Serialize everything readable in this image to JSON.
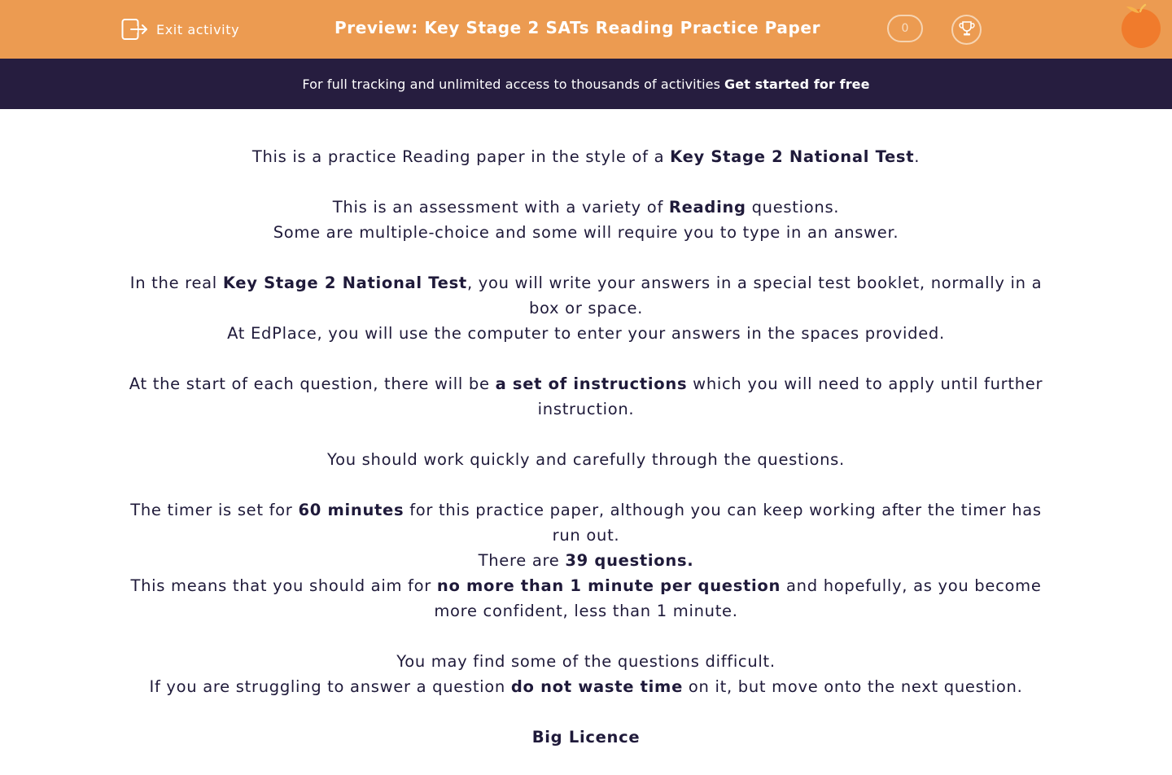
{
  "header": {
    "exit_label": "Exit activity",
    "title": "Preview: Key Stage 2 SATs Reading Practice Paper",
    "score": "0",
    "icons": [
      "exit-icon",
      "trophy-icon",
      "orange-logo-icon"
    ]
  },
  "banner": {
    "text": "For full tracking and unlimited access to thousands of activities",
    "cta": "Get started for free"
  },
  "intro": {
    "p1": {
      "a": "This is a practice Reading paper in the style of a ",
      "b": "Key Stage 2 National Test",
      "c": "."
    },
    "p2": {
      "l1a": "This is an assessment with a variety of ",
      "l1b": "Reading",
      "l1c": " questions.",
      "l2": "Some are multiple-choice and some will require you to type in an answer."
    },
    "p3": {
      "l1a": "In the real ",
      "l1b": "Key Stage 2 National Test",
      "l1c": ", you will write your answers in a special test booklet, normally in a box or space.",
      "l2": "At EdPlace, you will use the computer to enter your answers in the spaces provided."
    },
    "p4": {
      "a": "At the start of each question, there will be ",
      "b": "a set of instructions",
      "c": " which you will need to apply until further instruction."
    },
    "p5": "You should work quickly and carefully through the questions.",
    "p6": {
      "l1a": "The timer is set for ",
      "l1b": "60 minutes",
      "l1c": " for this practice paper, although you can keep working after the timer has run out.",
      "l2a": "There are ",
      "l2b": "39 questions.",
      "l3a": "This means that you should aim for ",
      "l3b": "no more than 1 minute per question",
      "l3c": " and hopefully, as you become more confident, less than 1 minute."
    },
    "p7": {
      "l1": "You may find some of the questions difficult.",
      "l2a": "If you are struggling to answer a question ",
      "l2b": "do not waste time",
      "l2c": " on it, but move onto the next question."
    },
    "p8": "Big Licence"
  },
  "colors": {
    "header_bg": "#ec9b51",
    "banner_bg": "#261d3f",
    "text": "#1f1a3a"
  }
}
